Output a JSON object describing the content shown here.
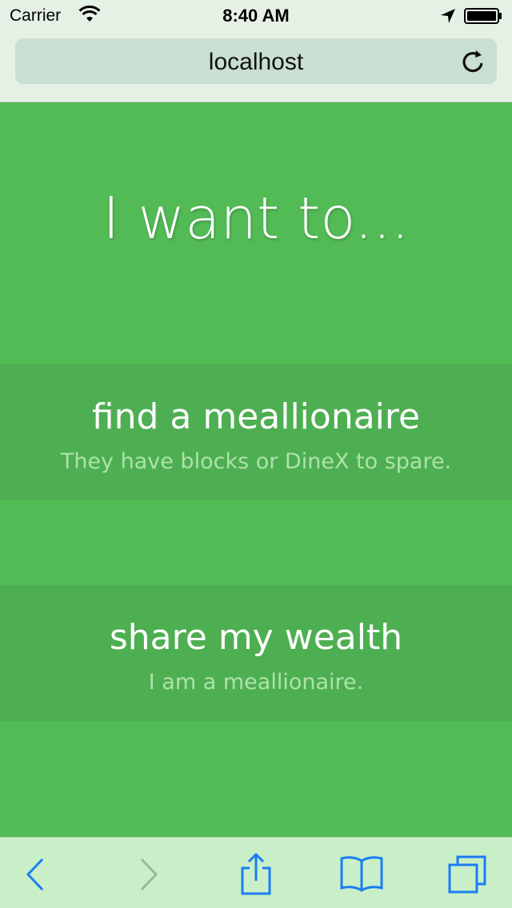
{
  "status_bar": {
    "carrier": "Carrier",
    "time": "8:40 AM",
    "icons": [
      "wifi-icon",
      "location-arrow-icon",
      "battery-icon"
    ]
  },
  "browser": {
    "url": "localhost",
    "reload_icon": "reload-icon",
    "toolbar_icons": [
      "back-icon",
      "forward-icon",
      "share-icon",
      "bookmarks-icon",
      "tabs-icon"
    ],
    "accent_color": "#1a7cf5",
    "disabled_color": "#9ab89a"
  },
  "page": {
    "heading": "I want to...",
    "options": [
      {
        "title": "find a meallionaire",
        "subtitle": "They have blocks or DineX to spare."
      },
      {
        "title": "share my wealth",
        "subtitle": "I am a meallionaire."
      }
    ],
    "colors": {
      "background": "#52bb55",
      "option_background": "#4daf51",
      "text": "#ffffff",
      "subtext": "#aee2a9"
    }
  }
}
